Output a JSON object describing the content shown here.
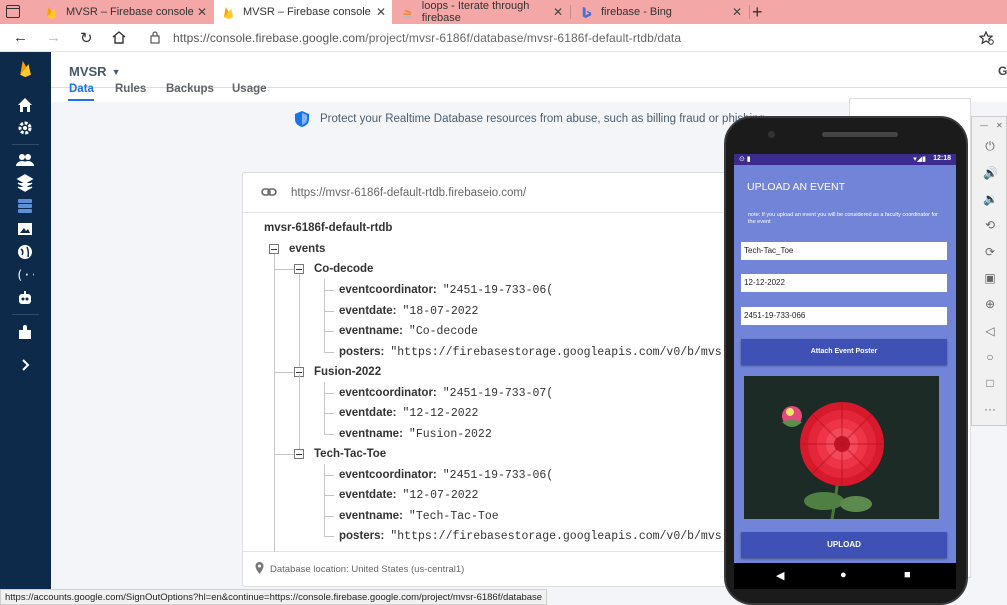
{
  "browser": {
    "tabs": [
      {
        "title": "MVSR – Firebase console",
        "active": false
      },
      {
        "title": "MVSR – Firebase console",
        "active": true
      },
      {
        "title": "loops - Iterate through firebase",
        "active": false
      },
      {
        "title": "firebase - Bing",
        "active": false
      }
    ],
    "url_host": "https://console.firebase.google.com",
    "url_path": "/project/mvsr-6186f/database/mvsr-6186f-default-rtdb/data",
    "status_url": "https://accounts.google.com/SignOutOptions?hl=en&continue=https://console.firebase.google.com/project/mvsr-6186f/database"
  },
  "firebase": {
    "project": "MVSR",
    "header_right": "Gc",
    "subtabs": [
      "Data",
      "Rules",
      "Backups",
      "Usage"
    ],
    "banner": "Protect your Realtime Database resources from abuse, such as billing fraud or phishing",
    "db_url": "https://mvsr-6186f-default-rtdb.firebaseio.com/",
    "db_location": "Database location: United States (us-central1)",
    "root": "mvsr-6186f-default-rtdb",
    "events_key": "events",
    "events": [
      {
        "name": "Co-decode",
        "fields": [
          {
            "key": "eventcoordinator:",
            "value": "\"2451-19-733-06("
          },
          {
            "key": "eventdate:",
            "value": "\"18-07-2022"
          },
          {
            "key": "eventname:",
            "value": "\"Co-decode"
          },
          {
            "key": "posters:",
            "value": "\"https://firebasestorage.googleapis.com/v0/b/mvs"
          }
        ]
      },
      {
        "name": "Fusion-2022",
        "fields": [
          {
            "key": "eventcoordinator:",
            "value": "\"2451-19-733-07("
          },
          {
            "key": "eventdate:",
            "value": "\"12-12-2022"
          },
          {
            "key": "eventname:",
            "value": "\"Fusion-2022"
          }
        ]
      },
      {
        "name": "Tech-Tac-Toe",
        "fields": [
          {
            "key": "eventcoordinator:",
            "value": "\"2451-19-733-06("
          },
          {
            "key": "eventdate:",
            "value": "\"12-07-2022"
          },
          {
            "key": "eventname:",
            "value": "\"Tech-Tac-Toe"
          },
          {
            "key": "posters:",
            "value": "\"https://firebasestorage.googleapis.com/v0/b/mvs"
          }
        ]
      }
    ]
  },
  "phone": {
    "time": "12:18",
    "title": "UPLOAD AN EVENT",
    "note": "note: If you upload an event you will be considered as a faculty coordinator for the event",
    "event_name": "Tech-Tac_Toe",
    "event_date": "12-12-2022",
    "coordinator": "2451-19-733-066",
    "attach_label": "Attach Event Poster",
    "upload_label": "UPLOAD"
  },
  "colors": {
    "sidebar": "#0d2a4a",
    "accent": "#1a73e8",
    "phone_bg": "#7284d8",
    "phone_button": "#3f51b5"
  }
}
